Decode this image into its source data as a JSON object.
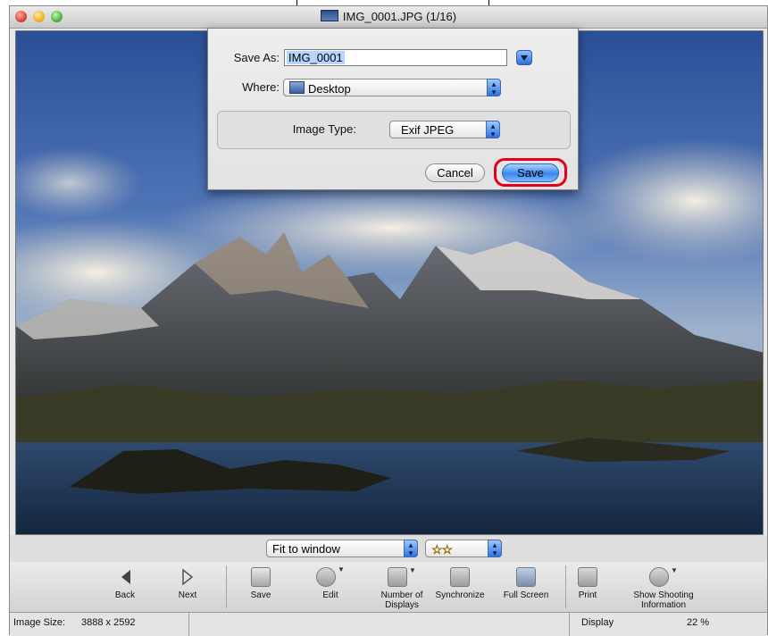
{
  "window": {
    "title": "IMG_0001.JPG (1/16)"
  },
  "dialog": {
    "save_as_label": "Save As:",
    "save_as_value": "IMG_0001",
    "where_label": "Where:",
    "where_value": "Desktop",
    "image_type_label": "Image Type:",
    "image_type_value": "Exif JPEG",
    "cancel_label": "Cancel",
    "save_label": "Save"
  },
  "viewbar": {
    "fit_value": "Fit to window",
    "rating_value": "☆☆"
  },
  "toolbar": {
    "back": "Back",
    "next": "Next",
    "save": "Save",
    "edit": "Edit",
    "number_of_displays": "Number of Displays",
    "synchronize": "Synchronize",
    "full_screen": "Full Screen",
    "print": "Print",
    "show_shooting_information": "Show Shooting Information"
  },
  "status": {
    "image_size_label": "Image Size:",
    "image_size_value": "3888 x 2592",
    "display_label": "Display",
    "display_value": "22 %"
  },
  "colors": {
    "highlight": "#e2001a",
    "accent_blue": "#3b86f0"
  }
}
